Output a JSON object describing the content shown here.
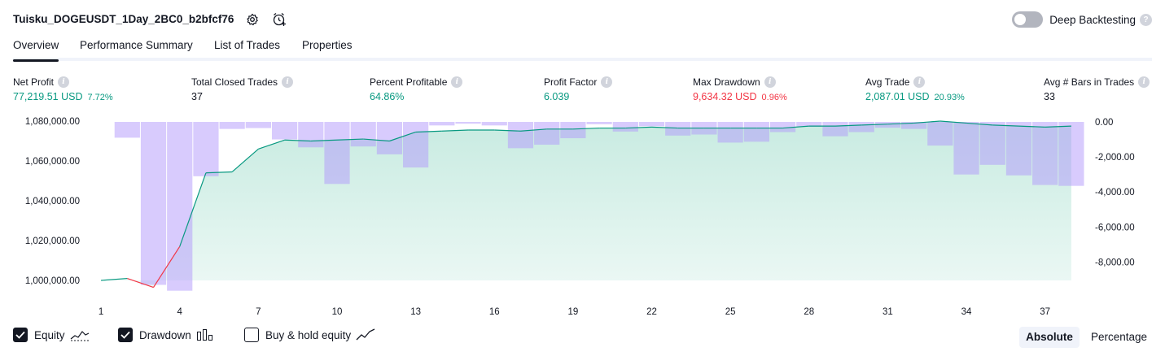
{
  "header": {
    "strategy_title": "Tuisku_DOGEUSDT_1Day_2BC0_b2bfcf76",
    "settings_icon": "gear-icon",
    "alert_icon": "add-alert-clock-icon",
    "deep_backtesting_label": "Deep Backtesting",
    "deep_backtesting_enabled": false,
    "help_glyph": "?"
  },
  "tabs": [
    {
      "label": "Overview",
      "active": true
    },
    {
      "label": "Performance Summary",
      "active": false
    },
    {
      "label": "List of Trades",
      "active": false
    },
    {
      "label": "Properties",
      "active": false
    }
  ],
  "metrics": [
    {
      "label": "Net Profit",
      "value": "77,219.51 USD",
      "pct": "7.72%",
      "color": "green"
    },
    {
      "label": "Total Closed Trades",
      "value": "37",
      "pct": "",
      "color": "dark"
    },
    {
      "label": "Percent Profitable",
      "value": "64.86%",
      "pct": "",
      "color": "green"
    },
    {
      "label": "Profit Factor",
      "value": "6.039",
      "pct": "",
      "color": "green"
    },
    {
      "label": "Max Drawdown",
      "value": "9,634.32 USD",
      "pct": "0.96%",
      "color": "red"
    },
    {
      "label": "Avg Trade",
      "value": "2,087.01 USD",
      "pct": "20.93%",
      "color": "green"
    },
    {
      "label": "Avg # Bars in Trades",
      "value": "33",
      "pct": "",
      "color": "dark"
    }
  ],
  "info_glyph": "i",
  "chart_data": {
    "type": "line+bar",
    "x_ticks": [
      "1",
      "4",
      "7",
      "10",
      "13",
      "16",
      "19",
      "22",
      "25",
      "28",
      "31",
      "34",
      "37"
    ],
    "left_axis": {
      "ticks": [
        "1,080,000.00",
        "1,060,000.00",
        "1,040,000.00",
        "1,020,000.00",
        "1,000,000.00"
      ],
      "ylim": [
        1000000,
        1080000
      ]
    },
    "right_axis": {
      "ticks": [
        "0.00",
        "-2,000.00",
        "-4,000.00",
        "-6,000.00",
        "-8,000.00"
      ],
      "ylim": [
        -9000,
        0
      ]
    },
    "series": [
      {
        "name": "Equity",
        "type": "area",
        "color": "#089981",
        "fill": "#c8ebe1",
        "negative_color": "#f23645",
        "x": [
          1,
          2,
          3,
          4,
          5,
          6,
          7,
          8,
          9,
          10,
          11,
          12,
          13,
          14,
          15,
          16,
          17,
          18,
          19,
          20,
          21,
          22,
          23,
          24,
          25,
          26,
          27,
          28,
          29,
          30,
          31,
          32,
          33,
          34,
          35,
          36,
          37,
          38
        ],
        "values": [
          1000000,
          1001000,
          996500,
          1017000,
          1054000,
          1054500,
          1066000,
          1070500,
          1070000,
          1070500,
          1071000,
          1070000,
          1074500,
          1075000,
          1075500,
          1075500,
          1075000,
          1076000,
          1076000,
          1076500,
          1076500,
          1077000,
          1076500,
          1076500,
          1076500,
          1076500,
          1076500,
          1077500,
          1077500,
          1078000,
          1078500,
          1079000,
          1080000,
          1079000,
          1078000,
          1077500,
          1077000,
          1077500
        ]
      },
      {
        "name": "Drawdown",
        "type": "bar",
        "color": "#b197fc",
        "x": [
          1,
          2,
          3,
          4,
          5,
          6,
          7,
          8,
          9,
          10,
          11,
          12,
          13,
          14,
          15,
          16,
          17,
          18,
          19,
          20,
          21,
          22,
          23,
          24,
          25,
          26,
          27,
          28,
          29,
          30,
          31,
          32,
          33,
          34,
          35,
          36,
          37,
          38
        ],
        "values": [
          0,
          -900,
          -9300,
          -9634.32,
          -3100,
          -400,
          -350,
          -1000,
          -1450,
          -3540,
          -1400,
          -1850,
          -2600,
          -200,
          -100,
          -200,
          -1500,
          -1300,
          -930,
          -130,
          -550,
          -250,
          -780,
          -720,
          -1180,
          -1130,
          -580,
          -280,
          -820,
          -580,
          -330,
          -400,
          -1350,
          -3000,
          -2450,
          -3050,
          -3600,
          -3650
        ]
      }
    ]
  },
  "footer": {
    "checkboxes": [
      {
        "label": "Equity",
        "checked": true,
        "icon": "equity-line-icon"
      },
      {
        "label": "Drawdown",
        "checked": true,
        "icon": "drawdown-bars-icon"
      },
      {
        "label": "Buy & hold equity",
        "checked": false,
        "icon": "buy-hold-line-icon"
      }
    ],
    "scale_options": [
      {
        "label": "Absolute",
        "active": true
      },
      {
        "label": "Percentage",
        "active": false
      }
    ]
  }
}
